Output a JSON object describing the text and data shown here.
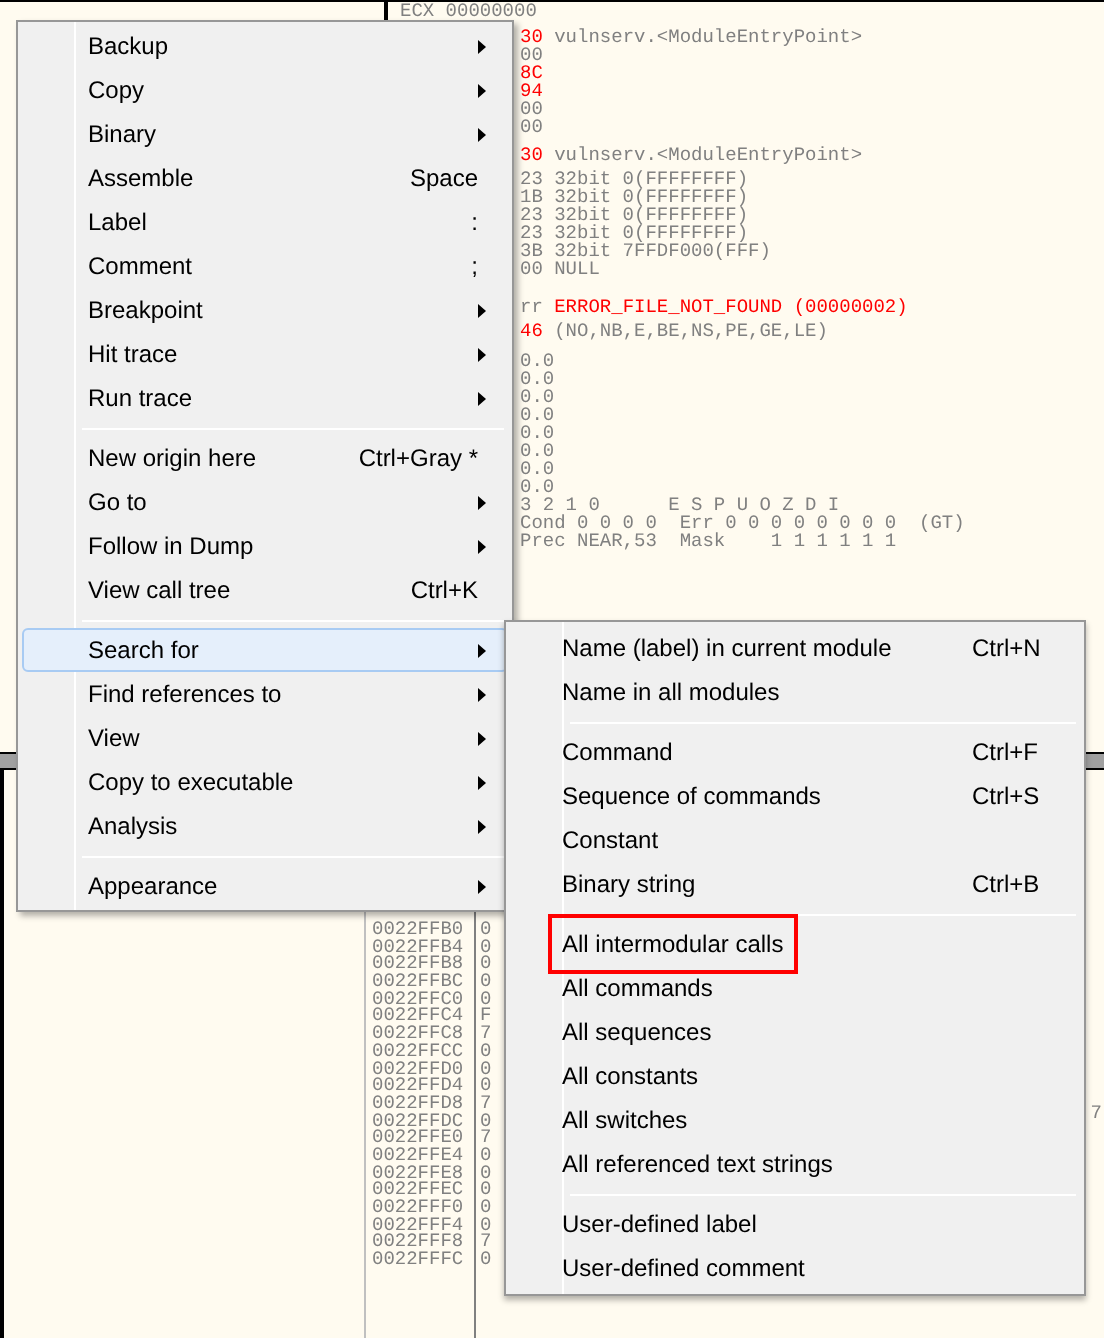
{
  "registers": {
    "header": "ECX 00000000",
    "blocks": [
      [
        {
          "parts": [
            {
              "text": "30",
              "color": "#ff0000"
            },
            {
              "text": " vulnserv.<ModuleEntryPoint>",
              "color": "#808080"
            }
          ]
        },
        {
          "parts": [
            {
              "text": "00",
              "color": "#808080"
            }
          ]
        },
        {
          "parts": [
            {
              "text": "8C",
              "color": "#ff0000"
            }
          ]
        },
        {
          "parts": [
            {
              "text": "94",
              "color": "#ff0000"
            }
          ]
        },
        {
          "parts": [
            {
              "text": "00",
              "color": "#808080"
            }
          ]
        },
        {
          "parts": [
            {
              "text": "00",
              "color": "#808080"
            }
          ]
        }
      ],
      [
        {
          "parts": [
            {
              "text": "30",
              "color": "#ff0000"
            },
            {
              "text": " vulnserv.<ModuleEntryPoint>",
              "color": "#808080"
            }
          ]
        }
      ],
      [
        {
          "parts": [
            {
              "text": "23 32bit 0(FFFFFFFF)",
              "color": "#808080"
            }
          ]
        },
        {
          "parts": [
            {
              "text": "1B 32bit 0(FFFFFFFF)",
              "color": "#808080"
            }
          ]
        },
        {
          "parts": [
            {
              "text": "23 32bit 0(FFFFFFFF)",
              "color": "#808080"
            }
          ]
        },
        {
          "parts": [
            {
              "text": "23 32bit 0(FFFFFFFF)",
              "color": "#808080"
            }
          ]
        },
        {
          "parts": [
            {
              "text": "3B 32bit 7FFDF000(FFF)",
              "color": "#808080"
            }
          ]
        },
        {
          "parts": [
            {
              "text": "00 NULL",
              "color": "#808080"
            }
          ]
        }
      ],
      [
        {
          "parts": [
            {
              "text": "rr",
              "color": "#808080"
            },
            {
              "text": " ERROR_FILE_NOT_FOUND (00000002)",
              "color": "#ff0000"
            }
          ]
        }
      ],
      [
        {
          "parts": [
            {
              "text": "46",
              "color": "#ff0000"
            },
            {
              "text": " (NO,NB,E,BE,NS,PE,GE,LE)",
              "color": "#808080"
            }
          ]
        }
      ],
      [
        {
          "parts": [
            {
              "text": "0.0",
              "color": "#808080"
            }
          ]
        },
        {
          "parts": [
            {
              "text": "0.0",
              "color": "#808080"
            }
          ]
        },
        {
          "parts": [
            {
              "text": "0.0",
              "color": "#808080"
            }
          ]
        },
        {
          "parts": [
            {
              "text": "0.0",
              "color": "#808080"
            }
          ]
        },
        {
          "parts": [
            {
              "text": "0.0",
              "color": "#808080"
            }
          ]
        },
        {
          "parts": [
            {
              "text": "0.0",
              "color": "#808080"
            }
          ]
        },
        {
          "parts": [
            {
              "text": "0.0",
              "color": "#808080"
            }
          ]
        },
        {
          "parts": [
            {
              "text": "0.0",
              "color": "#808080"
            }
          ]
        },
        {
          "parts": [
            {
              "text": "3 2 1 0      E S P U O Z D I",
              "color": "#808080"
            }
          ]
        },
        {
          "parts": [
            {
              "text": "Cond 0 0 0 0  Err 0 0 0 0 0 0 0 0  (GT)",
              "color": "#808080"
            }
          ]
        },
        {
          "parts": [
            {
              "text": "Prec NEAR,53  Mask    1 1 1 1 1 1",
              "color": "#808080"
            }
          ]
        }
      ]
    ]
  },
  "stack": {
    "rows": [
      {
        "address": "0022FFB0",
        "value": "0"
      },
      {
        "address": "0022FFB4",
        "value": "0"
      },
      {
        "address": "0022FFB8",
        "value": "0"
      },
      {
        "address": "0022FFBC",
        "value": "0"
      },
      {
        "address": "0022FFC0",
        "value": "0"
      },
      {
        "address": "0022FFC4",
        "value": "F"
      },
      {
        "address": "0022FFC8",
        "value": "7"
      },
      {
        "address": "0022FFCC",
        "value": "0"
      },
      {
        "address": "0022FFD0",
        "value": "0"
      },
      {
        "address": "0022FFD4",
        "value": "0"
      },
      {
        "address": "0022FFD8",
        "value": "7"
      },
      {
        "address": "0022FFDC",
        "value": "0"
      },
      {
        "address": "0022FFE0",
        "value": "7"
      },
      {
        "address": "0022FFE4",
        "value": "0"
      },
      {
        "address": "0022FFE8",
        "value": "0"
      },
      {
        "address": "0022FFEC",
        "value": "0"
      },
      {
        "address": "0022FFF0",
        "value": "0"
      },
      {
        "address": "0022FFF4",
        "value": "0"
      },
      {
        "address": "0022FFF8",
        "value": "7"
      },
      {
        "address": "0022FFFC",
        "value": "0"
      }
    ],
    "side_text": "7"
  },
  "context_menu": {
    "groups": [
      [
        {
          "label": "Backup",
          "submenu": true,
          "selected": false
        },
        {
          "label": "Copy",
          "submenu": true,
          "selected": false
        },
        {
          "label": "Binary",
          "submenu": true,
          "selected": false
        },
        {
          "label": "Assemble",
          "shortcut": "Space",
          "submenu": false,
          "selected": false
        },
        {
          "label": "Label",
          "shortcut": ":",
          "submenu": false,
          "selected": false
        },
        {
          "label": "Comment",
          "shortcut": ";",
          "submenu": false,
          "selected": false
        },
        {
          "label": "Breakpoint",
          "submenu": true,
          "selected": false
        },
        {
          "label": "Hit trace",
          "submenu": true,
          "selected": false
        },
        {
          "label": "Run trace",
          "submenu": true,
          "selected": false
        }
      ],
      [
        {
          "label": "New origin here",
          "shortcut": "Ctrl+Gray *",
          "submenu": false,
          "selected": false
        },
        {
          "label": "Go to",
          "submenu": true,
          "selected": false
        },
        {
          "label": "Follow in Dump",
          "submenu": true,
          "selected": false
        },
        {
          "label": "View call tree",
          "shortcut": "Ctrl+K",
          "submenu": false,
          "selected": false
        }
      ],
      [
        {
          "label": "Search for",
          "submenu": true,
          "selected": true
        },
        {
          "label": "Find references to",
          "submenu": true,
          "selected": false
        },
        {
          "label": "View",
          "submenu": true,
          "selected": false
        },
        {
          "label": "Copy to executable",
          "submenu": true,
          "selected": false
        },
        {
          "label": "Analysis",
          "submenu": true,
          "selected": false
        }
      ],
      [
        {
          "label": "Appearance",
          "submenu": true,
          "selected": false
        }
      ]
    ]
  },
  "search_submenu": {
    "groups": [
      [
        {
          "label": "Name (label) in current module",
          "shortcut": "Ctrl+N",
          "marked": false
        },
        {
          "label": "Name in all modules",
          "marked": false
        }
      ],
      [
        {
          "label": "Command",
          "shortcut": "Ctrl+F",
          "marked": false
        },
        {
          "label": "Sequence of commands",
          "shortcut": "Ctrl+S",
          "marked": false
        },
        {
          "label": "Constant",
          "marked": false
        },
        {
          "label": "Binary string",
          "shortcut": "Ctrl+B",
          "marked": false
        }
      ],
      [
        {
          "label": "All intermodular calls",
          "marked": true
        },
        {
          "label": "All commands",
          "marked": false
        },
        {
          "label": "All sequences",
          "marked": false
        },
        {
          "label": "All constants",
          "marked": false
        },
        {
          "label": "All switches",
          "marked": false
        },
        {
          "label": "All referenced text strings",
          "marked": false
        }
      ],
      [
        {
          "label": "User-defined label",
          "marked": false
        },
        {
          "label": "User-defined comment",
          "marked": false
        }
      ]
    ]
  }
}
